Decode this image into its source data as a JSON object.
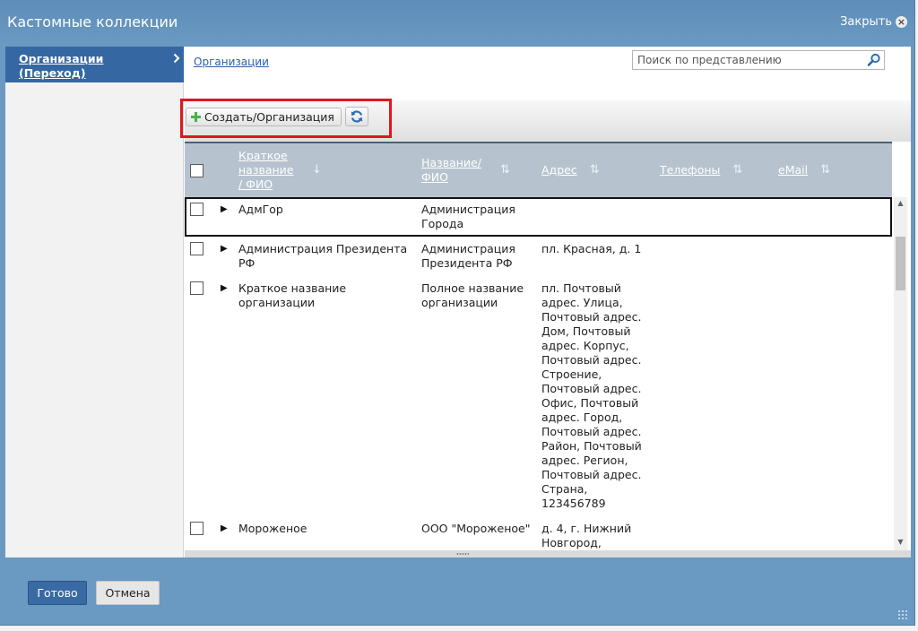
{
  "dialog": {
    "title": "Кастомные коллекции",
    "close_label": "Закрыть",
    "close_icon": "close-circle-icon"
  },
  "sidebar": {
    "items": [
      {
        "label": "Организации (Переход)",
        "icon": "chevron-right-icon",
        "selected": true
      }
    ]
  },
  "breadcrumb": {
    "label": "Организации"
  },
  "search": {
    "placeholder": "Поиск по представлению",
    "value": "",
    "icon": "search-icon"
  },
  "toolbar": {
    "create_label": "Создать/Организация",
    "create_icon": "plus-icon",
    "refresh_icon": "refresh-icon"
  },
  "table": {
    "select_all_checked": false,
    "columns": [
      {
        "label": "Краткое название / ФИО",
        "sort_icon": "sort-desc-icon"
      },
      {
        "label": "Название/ ФИО",
        "sort_icon": "sort-icon"
      },
      {
        "label": "Адрес",
        "sort_icon": "sort-icon"
      },
      {
        "label": "Телефоны",
        "sort_icon": "sort-icon"
      },
      {
        "label": "eMail",
        "sort_icon": "sort-icon"
      }
    ],
    "rows": [
      {
        "checked": false,
        "expand_icon": "expand-arrow-icon",
        "selected": true,
        "short_name": "АдмГор",
        "name": "Администрация Города",
        "address": "",
        "phones": "",
        "email": ""
      },
      {
        "checked": false,
        "expand_icon": "expand-arrow-icon",
        "selected": false,
        "short_name": "Администрация Президента РФ",
        "name": "Администрация Президента РФ",
        "address": "пл. Красная, д. 1",
        "phones": "",
        "email": ""
      },
      {
        "checked": false,
        "expand_icon": "expand-arrow-icon",
        "selected": false,
        "short_name": "Краткое название организации",
        "name": "Полное название организации",
        "address": "пл. Почтовый адрес. Улица, Почтовый адрес. Дом, Почтовый адрес. Корпус, Почтовый адрес. Строение, Почтовый адрес. Офис, Почтовый адрес. Город, Почтовый адрес. Район, Почтовый адрес. Регион, Почтовый адрес. Страна, 123456789",
        "phones": "",
        "email": ""
      },
      {
        "checked": false,
        "expand_icon": "expand-arrow-icon",
        "selected": false,
        "short_name": "Мороженое",
        "name": "ООО \"Мороженое\"",
        "address": "д. 4, г. Нижний Новгород,",
        "phones": "",
        "email": ""
      }
    ]
  },
  "footer": {
    "ok_label": "Готово",
    "cancel_label": "Отмена"
  },
  "colors": {
    "frame": "#6a99c2",
    "selected_nav_item": "#3567a2",
    "table_header": "#b6c3cf",
    "highlight_box": "#e3151d",
    "ok_button": "#3a6aa3",
    "cancel_button": "#e6e6e6",
    "plus_icon": "#4bb14b",
    "refresh_icon": "#2e6db3"
  }
}
